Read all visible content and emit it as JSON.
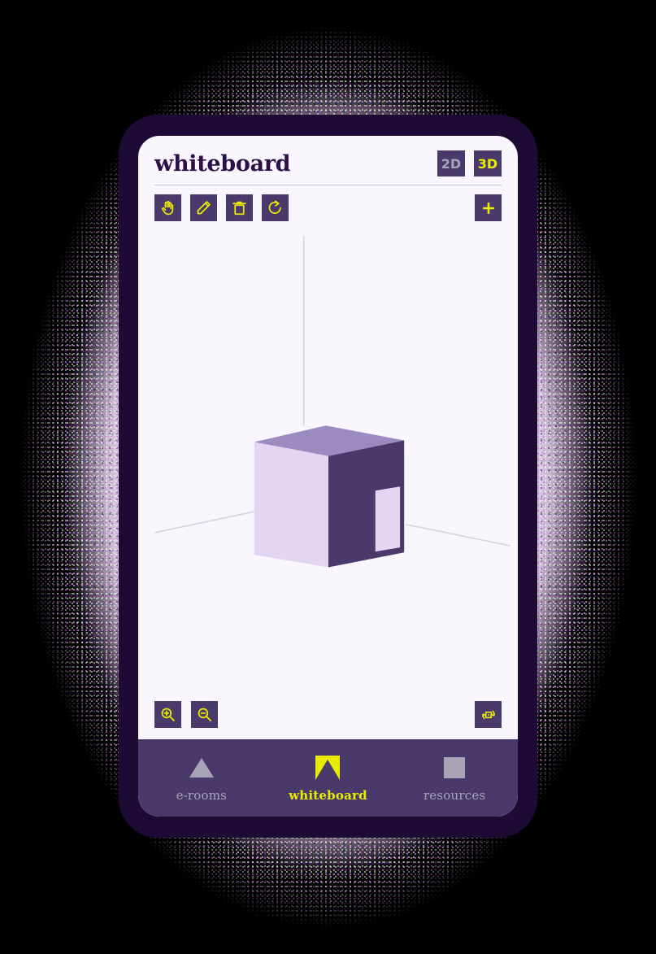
{
  "app": {
    "title": "whiteboard"
  },
  "header": {
    "title": "whiteboard",
    "dimension_toggle": {
      "options": [
        {
          "label": "2D",
          "active": false,
          "color": "#a9a3b8"
        },
        {
          "label": "3D",
          "active": true,
          "color": "#e9ec00"
        }
      ]
    }
  },
  "toolbar": {
    "tools": [
      {
        "name": "pan-hand-tool",
        "label": "hand",
        "icon": "hand-icon"
      },
      {
        "name": "draw-pencil-tool",
        "label": "pencil",
        "icon": "pencil-icon"
      },
      {
        "name": "delete-tool",
        "label": "delete",
        "icon": "trash-icon"
      },
      {
        "name": "reset-tool",
        "label": "reset",
        "icon": "refresh-icon"
      }
    ],
    "add_button": {
      "label": "add",
      "icon": "plus-icon"
    }
  },
  "canvas": {
    "view_mode": "3D",
    "axes": {
      "vertical_axis_visible": true,
      "ground_lines_visible": true,
      "line_color": "#d8d3e0"
    },
    "objects": [
      {
        "type": "cube",
        "name": "room-cube",
        "faces": {
          "left_color": "#e2d6f2",
          "top_color": "#9b8bc0",
          "right_color": "#4a3a6b"
        },
        "door": {
          "visible": true,
          "color": "#e2d6f2"
        }
      }
    ],
    "controls": {
      "zoom_in": {
        "label": "zoom in",
        "icon": "zoom-in-icon"
      },
      "zoom_out": {
        "label": "zoom out",
        "icon": "zoom-out-icon"
      },
      "orbit": {
        "label": "orbit",
        "icon": "orbit-icon"
      }
    }
  },
  "bottom_nav": {
    "items": [
      {
        "label": "e-rooms",
        "icon": "triangle-icon",
        "active": false
      },
      {
        "label": "whiteboard",
        "icon": "notched-square-icon",
        "active": true
      },
      {
        "label": "resources",
        "icon": "square-icon",
        "active": false
      }
    ]
  },
  "colors": {
    "bezel": "#1e0b35",
    "screen": "#f9f6fd",
    "purple": "#4a3a6b",
    "yellow": "#e9ec00",
    "gray": "#a9a3b8",
    "title": "#2e1048"
  }
}
